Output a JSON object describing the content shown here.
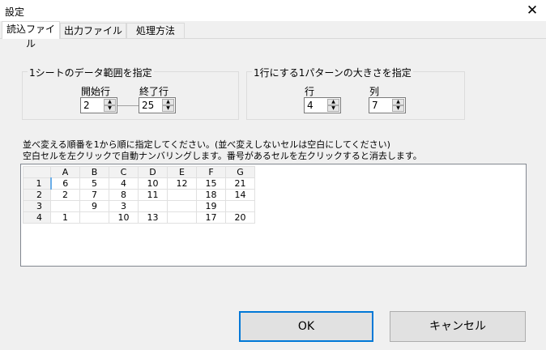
{
  "window": {
    "title": "設定",
    "close_glyph": "✕"
  },
  "tabs": [
    {
      "label": "読込ファイル",
      "active": true
    },
    {
      "label": "出力ファイル",
      "active": false
    },
    {
      "label": "処理方法",
      "active": false
    }
  ],
  "data_range": {
    "group_label": "1シートのデータ範囲を指定",
    "start_label": "開始行",
    "start_value": "2",
    "end_label": "終了行",
    "end_value": "25"
  },
  "pattern_size": {
    "group_label": "1行にする1パターンの大きさを指定",
    "row_label": "行",
    "row_value": "4",
    "col_label": "列",
    "col_value": "7"
  },
  "instructions": {
    "line1": "並べ変える順番を1から順に指定してください。(並べ変えしないセルは空白にしてください)",
    "line2": "空白セルを左クリックで自動ナンバリングします。番号があるセルを左クリックすると消去します。"
  },
  "grid": {
    "columns": [
      "A",
      "B",
      "C",
      "D",
      "E",
      "F",
      "G"
    ],
    "rows": [
      {
        "label": "1",
        "cells": [
          "6",
          "5",
          "4",
          "10",
          "12",
          "15",
          "21"
        ]
      },
      {
        "label": "2",
        "cells": [
          "2",
          "7",
          "8",
          "11",
          "",
          "18",
          "14"
        ]
      },
      {
        "label": "3",
        "cells": [
          "",
          "9",
          "3",
          "",
          "",
          "19",
          ""
        ]
      },
      {
        "label": "4",
        "cells": [
          "1",
          "",
          "10",
          "13",
          "",
          "17",
          "20"
        ]
      }
    ]
  },
  "buttons": {
    "ok": "OK",
    "cancel": "キャンセル"
  },
  "colors": {
    "accent": "#0078d7",
    "background": "#f0f0f0"
  }
}
